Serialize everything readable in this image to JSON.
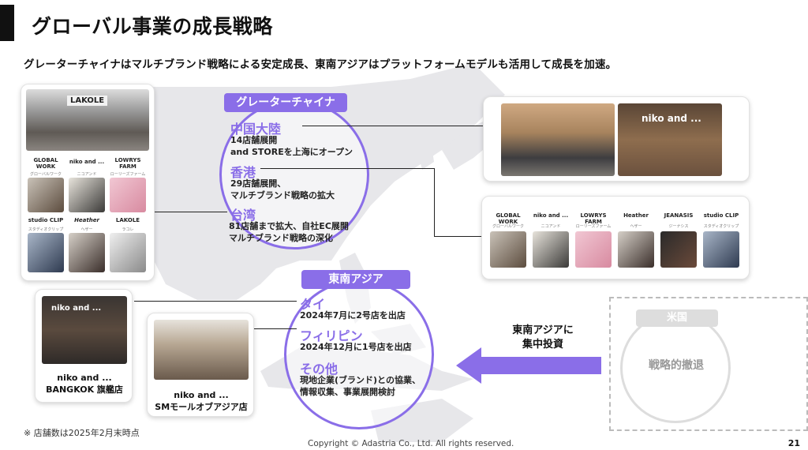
{
  "header": {
    "title": "グローバル事業の成長戦略",
    "subtitle": "グレーターチャイナはマルチブランド戦略による安定成長、東南アジアはプラットフォームモデルも活用して成長を加速。"
  },
  "greater_china": {
    "badge": "グレーターチャイナ",
    "regions": [
      {
        "name": "中国大陸",
        "lines": [
          "14店舗展開",
          "and STOREを上海にオープン"
        ]
      },
      {
        "name": "香港",
        "lines": [
          "29店舗展開、",
          "マルチブランド戦略の拡大"
        ]
      },
      {
        "name": "台湾",
        "lines": [
          "81店舗まで拡大、自社EC展開",
          "マルチブランド戦略の深化"
        ]
      }
    ]
  },
  "southeast_asia": {
    "badge": "東南アジア",
    "regions": [
      {
        "name": "タイ",
        "lines": [
          "2024年7月に2号店を出店"
        ]
      },
      {
        "name": "フィリピン",
        "lines": [
          "2024年12月に1号店を出店"
        ]
      },
      {
        "name": "その他",
        "lines": [
          "現地企業(ブランド)との協業、",
          "情報収集、事業展開検討"
        ]
      }
    ]
  },
  "arrow_label": [
    "東南アジアに",
    "集中投資"
  ],
  "usa": {
    "badge": "米国",
    "text": "戦略的撤退"
  },
  "left_card": {
    "storefront_sign": "LAKOLE",
    "brands_row1": [
      {
        "logo": "GLOBAL WORK",
        "sub": "グローバルワーク"
      },
      {
        "logo": "niko and ...",
        "sub": "ニコアンド"
      },
      {
        "logo": "LOWRYS FARM",
        "sub": "ローリーズファーム"
      }
    ],
    "brands_row2": [
      {
        "logo": "studio CLIP",
        "sub": "スタディオクリップ"
      },
      {
        "logo": "Heather",
        "sub": "ヘザー"
      },
      {
        "logo": "LAKOLE",
        "sub": "ラコレ"
      }
    ]
  },
  "right_brands": [
    {
      "logo": "GLOBAL WORK",
      "sub": "グローバルワーク"
    },
    {
      "logo": "niko and ...",
      "sub": "ニコアンド"
    },
    {
      "logo": "LOWRYS FARM",
      "sub": "ローリーズファーム"
    },
    {
      "logo": "Heather",
      "sub": "ヘザー"
    },
    {
      "logo": "JEANASIS",
      "sub": "ジーナシス"
    },
    {
      "logo": "studio CLIP",
      "sub": "スタディオクリップ"
    }
  ],
  "right_top_sign": "niko and ...",
  "bangkok": {
    "sign": "niko and ...",
    "caption": [
      "niko and ...",
      "BANGKOK 旗艦店"
    ]
  },
  "sm_mall": {
    "caption": [
      "niko and ...",
      "SMモールオブアジア店"
    ]
  },
  "footnote": "※ 店舗数は2025年2月末時点",
  "copyright": "Copyright © Adastria Co., Ltd. All rights reserved.",
  "page_number": "21",
  "colors": {
    "accent": "#8a6ee8",
    "map": "#e7e7ea",
    "text": "#111111"
  }
}
